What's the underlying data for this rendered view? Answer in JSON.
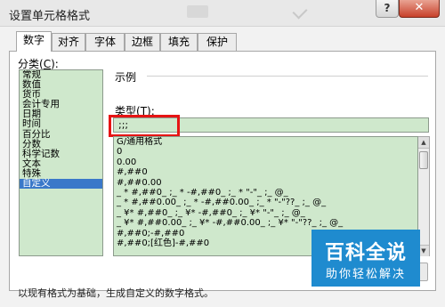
{
  "window": {
    "title": "设置单元格格式",
    "help_label": "?",
    "close_label": "✕"
  },
  "tabs": [
    {
      "label": "数字",
      "active": true
    },
    {
      "label": "对齐",
      "active": false
    },
    {
      "label": "字体",
      "active": false
    },
    {
      "label": "边框",
      "active": false
    },
    {
      "label": "填充",
      "active": false
    },
    {
      "label": "保护",
      "active": false
    }
  ],
  "category": {
    "label_pre": "分类(",
    "label_key": "C",
    "label_post": "):",
    "items": [
      "常规",
      "数值",
      "货币",
      "会计专用",
      "日期",
      "时间",
      "百分比",
      "分数",
      "科学记数",
      "文本",
      "特殊",
      "自定义"
    ],
    "selected": "自定义"
  },
  "sample": {
    "label": "示例"
  },
  "type": {
    "label_pre": "类型(",
    "label_key": "T",
    "label_post": "):",
    "value": ";;;"
  },
  "formats": [
    "G/通用格式",
    "0",
    "0.00",
    "#,##0",
    "#,##0.00",
    "_ * #,##0_ ;_ * -#,##0_ ;_ * \"-\"_ ;_ @_",
    "_ * #,##0.00_ ;_ * -#,##0.00_ ;_ * \"-\"??_ ;_ @_",
    "_ ¥* #,##0_ ;_ ¥* -#,##0_ ;_ ¥* \"-\"_ ;_ @_",
    "_ ¥* #,##0.00_ ;_ ¥* -#,##0.00_ ;_ ¥* \"-\"??_ ;_ @_",
    "#,##0;-#,##0",
    "#,##0;[红色]-#,##0"
  ],
  "description": "以现有格式为基础，生成自定义的数字格式。",
  "watermark": {
    "main": "百科全说",
    "sub": "助你轻松解决"
  },
  "colors": {
    "list_bg": "#cfe8cc",
    "selected": "#3a78c9",
    "highlight": "#e61414",
    "watermark": "#1f8bcf"
  }
}
